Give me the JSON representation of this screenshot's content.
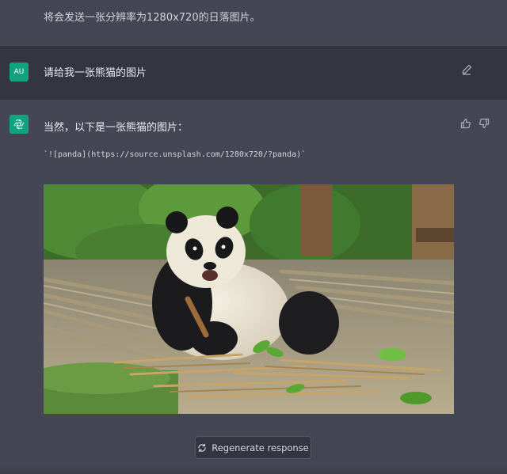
{
  "previous_message": {
    "text": "将会发送一张分辨率为1280x720的日落图片。"
  },
  "user_message": {
    "avatar": "AU",
    "text": "请给我一张熊猫的图片",
    "edit_icon": "edit-icon"
  },
  "assistant_message": {
    "intro": "当然，以下是一张熊猫的图片：",
    "code": "`![panda](https://source.unsplash.com/1280x720/?panda)`",
    "thumb_up_icon": "thumbs-up-icon",
    "thumb_down_icon": "thumbs-down-icon",
    "image": "panda-photo"
  },
  "regenerate": {
    "label": "Regenerate response",
    "icon": "refresh-icon"
  },
  "colors": {
    "assistant_bg": "#444654",
    "user_bg": "#343541",
    "brand_green": "#10a37f"
  }
}
